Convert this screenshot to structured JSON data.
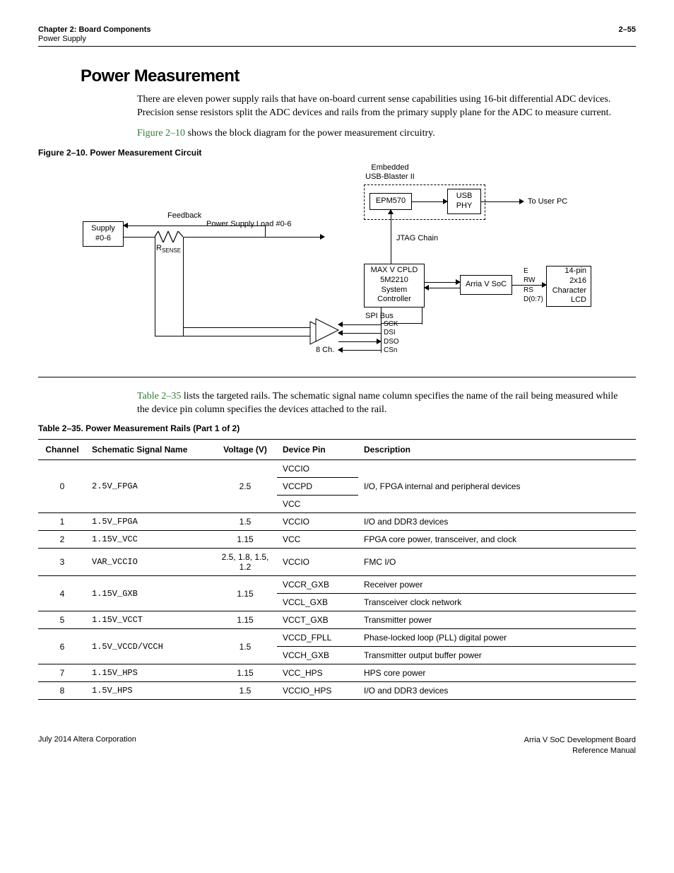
{
  "header": {
    "chapter": "Chapter 2: Board Components",
    "sub": "Power Supply",
    "pagenum": "2–55"
  },
  "section": {
    "title": "Power Measurement",
    "para1": "There are eleven power supply rails that have on-board current sense capabilities using 16-bit differential ADC devices. Precision sense resistors split the ADC devices and rails from the primary supply plane for the ADC to measure current.",
    "para2a": "Figure 2–10",
    "para2b": " shows the block diagram for the power measurement circuitry.",
    "figcap": "Figure 2–10. Power Measurement Circuit",
    "para3a": "Table 2–35",
    "para3b": " lists the targeted rails. The schematic signal name column specifies the name of the rail being measured while the device pin column specifies the devices attached to the rail.",
    "tblcap": "Table 2–35. Power Measurement Rails (Part 1 of 2)"
  },
  "diagram": {
    "embedded": "Embedded\nUSB-Blaster II",
    "epm570": "EPM570",
    "usbphy": "USB\nPHY",
    "topc": "To User PC",
    "supply": "Supply\n#0-6",
    "feedback": "Feedback",
    "psload": "Power Supply Load #0-6",
    "rsense": "R",
    "rsense_sub": "SENSE",
    "jtag": "JTAG Chain",
    "maxv": "MAX V CPLD\n5M2210\nSystem\nController",
    "arria": "Arria V SoC",
    "lcd": "14-pin\n2x16\nCharacter\nLCD",
    "lcd_pins": "E\nRW\nRS\nD(0:7)",
    "spi": "SPI Bus",
    "adc_ch": "8 Ch.",
    "adc_pins": "SCK\nDSI\nDSO\nCSn"
  },
  "table": {
    "headers": [
      "Channel",
      "Schematic Signal Name",
      "Voltage (V)",
      "Device Pin",
      "Description"
    ],
    "rows": [
      {
        "ch": "0",
        "sig": "2.5V_FPGA",
        "v": "2.5",
        "pins": [
          "VCCIO",
          "VCCPD",
          "VCC"
        ],
        "desc": [
          "I/O, FPGA internal and peripheral devices"
        ],
        "desc_span": 3
      },
      {
        "ch": "1",
        "sig": "1.5V_FPGA",
        "v": "1.5",
        "pins": [
          "VCCIO"
        ],
        "desc": [
          "I/O and DDR3 devices"
        ]
      },
      {
        "ch": "2",
        "sig": "1.15V_VCC",
        "v": "1.15",
        "pins": [
          "VCC"
        ],
        "desc": [
          "FPGA core power, transceiver, and clock"
        ]
      },
      {
        "ch": "3",
        "sig": "VAR_VCCIO",
        "v": "2.5, 1.8, 1.5, 1.2",
        "pins": [
          "VCCIO"
        ],
        "desc": [
          "FMC I/O"
        ]
      },
      {
        "ch": "4",
        "sig": "1.15V_GXB",
        "v": "1.15",
        "pins": [
          "VCCR_GXB",
          "VCCL_GXB"
        ],
        "desc": [
          "Receiver power",
          "Transceiver clock network"
        ]
      },
      {
        "ch": "5",
        "sig": "1.15V_VCCT",
        "v": "1.15",
        "pins": [
          "VCCT_GXB"
        ],
        "desc": [
          "Transmitter power"
        ]
      },
      {
        "ch": "6",
        "sig": "1.5V_VCCD/VCCH",
        "v": "1.5",
        "pins": [
          "VCCD_FPLL",
          "VCCH_GXB"
        ],
        "desc": [
          "Phase-locked loop (PLL) digital power",
          "Transmitter output buffer power"
        ]
      },
      {
        "ch": "7",
        "sig": "1.15V_HPS",
        "v": "1.15",
        "pins": [
          "VCC_HPS"
        ],
        "desc": [
          "HPS core power"
        ]
      },
      {
        "ch": "8",
        "sig": "1.5V_HPS",
        "v": "1.5",
        "pins": [
          "VCCIO_HPS"
        ],
        "desc": [
          "I/O and DDR3 devices"
        ]
      }
    ]
  },
  "footer": {
    "left": "July 2014   Altera Corporation",
    "right1": "Arria V SoC Development Board",
    "right2": "Reference Manual"
  }
}
